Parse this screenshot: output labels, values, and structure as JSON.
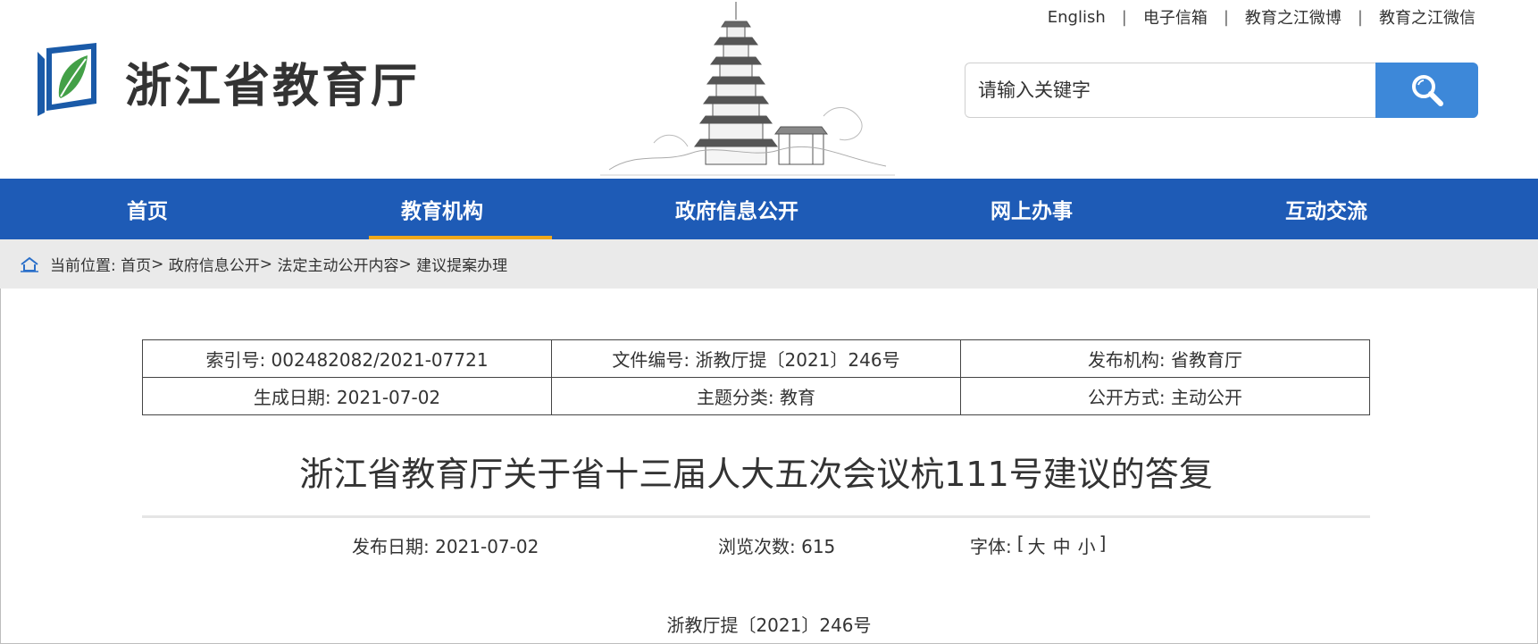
{
  "site": {
    "name": "浙江省教育厅"
  },
  "top_links": [
    "English",
    "电子信箱",
    "教育之江微博",
    "教育之江微信"
  ],
  "top_link_separator": "|",
  "search": {
    "placeholder": "请输入关键字"
  },
  "nav": {
    "items": [
      {
        "label": "首页"
      },
      {
        "label": "教育机构"
      },
      {
        "label": "政府信息公开"
      },
      {
        "label": "网上办事"
      },
      {
        "label": "互动交流"
      }
    ],
    "active_index": 1
  },
  "breadcrumb": {
    "prefix": "当前位置:",
    "items": [
      "首页",
      "政府信息公开",
      "法定主动公开内容",
      "建议提案办理"
    ],
    "separator": ">"
  },
  "meta": [
    [
      "索引号: 002482082/2021-07721",
      "文件编号: 浙教厅提〔2021〕246号",
      "发布机构: 省教育厅"
    ],
    [
      "生成日期: 2021-07-02",
      "主题分类: 教育",
      "公开方式: 主动公开"
    ]
  ],
  "article": {
    "title": "浙江省教育厅关于省十三届人大五次会议杭111号建议的答复",
    "publish_date": "发布日期: 2021-07-02",
    "views": "浏览次数: 615",
    "font_label": "字体: ",
    "font_open": "[",
    "font_sizes": [
      "大",
      "中",
      "小"
    ],
    "font_close": "]",
    "doc_number": "浙教厅提〔2021〕246号"
  },
  "colors": {
    "nav_bg": "#1e5bb6",
    "nav_active_underline": "#f0a81a",
    "search_button": "#3d88d9",
    "breadcrumb_bg": "#eaeaea"
  },
  "icons": {
    "logo": "edu-leaf-logo",
    "search": "search-icon",
    "home": "home-icon",
    "banner": "pagoda-illustration"
  }
}
